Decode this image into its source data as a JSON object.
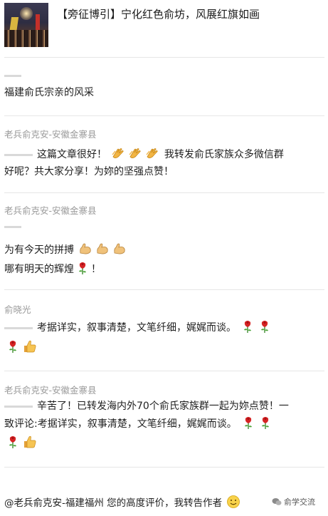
{
  "article": {
    "title": "【旁征博引】宁化红色俞坊，风展红旗如画"
  },
  "comments": [
    {
      "name": "",
      "text": "福建俞氏宗亲的风采"
    },
    {
      "name": "老兵俞克安-安徽金寨县",
      "line1": "这篇文章很好！",
      "line1b": "我转发俞氏家族众多微信群",
      "line2": "好呢？共大家分享！为妳的坚强点赞！"
    },
    {
      "name": "老兵俞克安-安徽金寨县",
      "line1": "为有今天的拼搏",
      "line2": "哪有明天的辉煌",
      "line2b": "！"
    },
    {
      "name": "俞晓光",
      "line1": "考据详实，叙事清楚，文笔纤细，娓娓而谈。"
    },
    {
      "name": "老兵俞克安-安徽金寨县",
      "line1": "辛苦了！已转发海内外70个俞氏家族群一起为妳点赞！一",
      "line2": "致评论:考据详实，叙事清楚，文笔纤细，娓娓而谈。"
    }
  ],
  "footer": {
    "text": "@老兵俞克安-福建福州 您的高度评价，我转告作者"
  },
  "watermark": {
    "text": "俞学交流"
  },
  "icons": {
    "clap": "clapping-hands-icon",
    "muscle": "flexed-biceps-icon",
    "rose": "rose-icon",
    "thumbs": "thumbs-up-icon",
    "smile": "smile-icon"
  }
}
